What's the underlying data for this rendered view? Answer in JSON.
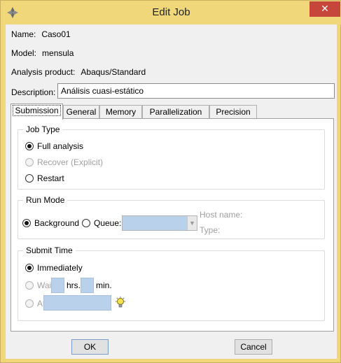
{
  "window": {
    "title": "Edit Job",
    "close_symbol": "✕"
  },
  "job": {
    "name_label": "Name:",
    "name_value": "Caso01",
    "model_label": "Model:",
    "model_value": "mensula",
    "product_label": "Analysis product:",
    "product_value": "Abaqus/Standard",
    "description_label": "Description:",
    "description_value": "Análisis cuasi-estático"
  },
  "tabs": [
    {
      "label": "Submission",
      "active": true
    },
    {
      "label": "General",
      "active": false
    },
    {
      "label": "Memory",
      "active": false
    },
    {
      "label": "Parallelization",
      "active": false
    },
    {
      "label": "Precision",
      "active": false
    }
  ],
  "job_type": {
    "title": "Job Type",
    "options": [
      {
        "label": "Full analysis",
        "selected": true,
        "enabled": true
      },
      {
        "label": "Recover (Explicit)",
        "selected": false,
        "enabled": false
      },
      {
        "label": "Restart",
        "selected": false,
        "enabled": true
      }
    ]
  },
  "run_mode": {
    "title": "Run Mode",
    "background_label": "Background",
    "background_selected": true,
    "queue_label": "Queue:",
    "queue_selected": false,
    "queue_value": "",
    "host_name_label": "Host name:",
    "type_label": "Type:"
  },
  "submit_time": {
    "title": "Submit Time",
    "immediately_label": "Immediately",
    "immediately_selected": true,
    "wait_label": "Wait:",
    "hrs_label": "hrs.",
    "min_label": "min.",
    "hrs_value": "",
    "min_value": "",
    "at_label": "At:",
    "at_value": "",
    "hint_icon": "lightbulb-icon"
  },
  "buttons": {
    "ok_label": "OK",
    "cancel_label": "Cancel"
  },
  "colors": {
    "titlebar": "#f0d77a",
    "close_button": "#c7463b",
    "input_highlight": "#b9d1ea"
  }
}
